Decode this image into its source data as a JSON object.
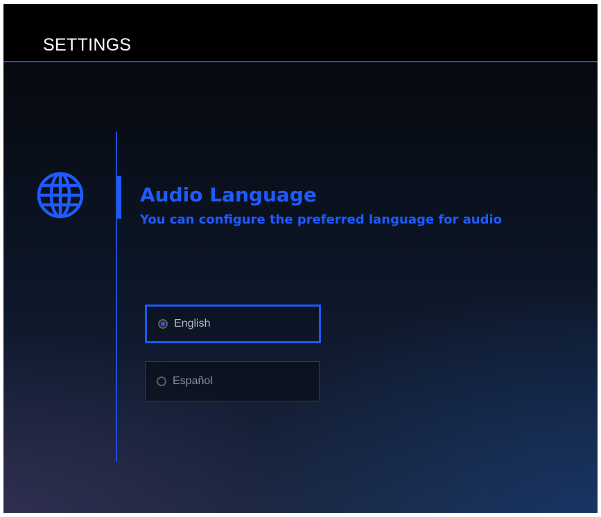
{
  "header": {
    "title": "SETTINGS"
  },
  "section": {
    "icon": "globe-icon",
    "title": "Audio Language",
    "description": "You can configure the preferred language for audio"
  },
  "options": [
    {
      "label": "English",
      "selected": true,
      "focused": true
    },
    {
      "label": "Español",
      "selected": false,
      "focused": false
    }
  ],
  "colors": {
    "accent": "#1f5aff",
    "header_background": "#000000",
    "header_text": "#ffffff",
    "option_text": "#b8bcc4"
  }
}
